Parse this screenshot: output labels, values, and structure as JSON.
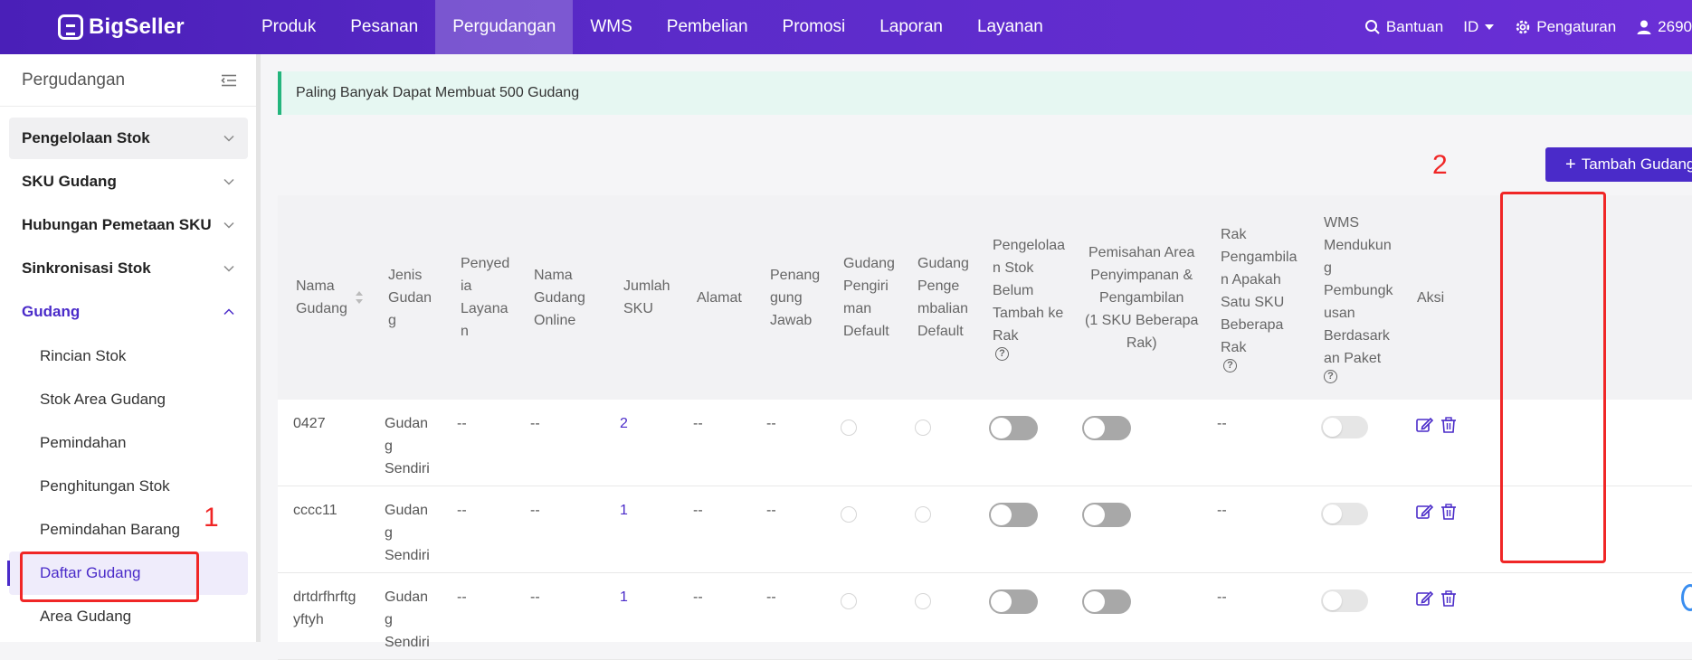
{
  "brand": {
    "name": "BigSeller"
  },
  "nav": {
    "items": [
      "Produk",
      "Pesanan",
      "Pergudangan",
      "WMS",
      "Pembelian",
      "Promosi",
      "Laporan",
      "Layanan"
    ],
    "active": "Pergudangan"
  },
  "topright": {
    "help": "Bantuan",
    "lang": "ID",
    "settings": "Pengaturan",
    "user": "2690"
  },
  "sidebar": {
    "title": "Pergudangan",
    "groups": [
      {
        "label": "Pengelolaan Stok"
      },
      {
        "label": "SKU Gudang"
      },
      {
        "label": "Hubungan Pemetaan SKU"
      },
      {
        "label": "Sinkronisasi Stok"
      },
      {
        "label": "Gudang"
      }
    ],
    "subitems": [
      "Rincian Stok",
      "Stok Area Gudang",
      "Pemindahan",
      "Penghitungan Stok",
      "Pemindahan Barang",
      "Daftar Gudang",
      "Area Gudang"
    ],
    "active_subitem": "Daftar Gudang"
  },
  "notice": "Paling Banyak Dapat Membuat 500 Gudang",
  "add_button": "Tambah Gudang",
  "table": {
    "headers": {
      "nama": [
        "Nama",
        "Gudang"
      ],
      "jenis": [
        "Jenis",
        "Gudan",
        "g"
      ],
      "penyedia": [
        "Penyed",
        "ia",
        "Layana",
        "n"
      ],
      "online": [
        "Nama",
        "Gudang",
        "Online"
      ],
      "jumlah": [
        "Jumlah",
        "SKU"
      ],
      "alamat": [
        "Alamat"
      ],
      "penanggung": [
        "Penang",
        "gung",
        "Jawab"
      ],
      "pengiriman": [
        "Gudang",
        "Pengiri",
        "man",
        "Default"
      ],
      "pengembalian": [
        "Gudang",
        "Penge",
        "mbalian",
        "Default"
      ],
      "pengelolaan": [
        "Pengelolaa",
        "n Stok",
        "Belum",
        "Tambah ke",
        "Rak"
      ],
      "pemisahan": [
        "Pemisahan Area",
        "Penyimpanan &",
        "Pengambilan",
        "(1 SKU Beberapa",
        "Rak)"
      ],
      "rak": [
        "Rak",
        "Pengambila",
        "n Apakah",
        "Satu SKU",
        "Beberapa",
        "Rak"
      ],
      "wms": [
        "WMS",
        "Mendukun",
        "g",
        "Pembungk",
        "usan",
        "Berdasark",
        "an Paket"
      ],
      "aksi": [
        "Aksi"
      ]
    },
    "rows": [
      {
        "nama": [
          "0427"
        ],
        "jenis": [
          "Gudan",
          "g",
          "Sendiri"
        ],
        "penyedia": "--",
        "online": "--",
        "jumlah": "2",
        "alamat": "--",
        "penanggung": "--",
        "rak": "--"
      },
      {
        "nama": [
          "cccc11"
        ],
        "jenis": [
          "Gudan",
          "g",
          "Sendiri"
        ],
        "penyedia": "--",
        "online": "--",
        "jumlah": "1",
        "alamat": "--",
        "penanggung": "--",
        "rak": "--"
      },
      {
        "nama": [
          "drtdrfhrftg",
          "yftyh"
        ],
        "jenis": [
          "Gudan",
          "g",
          "Sendiri"
        ],
        "penyedia": "--",
        "online": "--",
        "jumlah": "1",
        "alamat": "--",
        "penanggung": "--",
        "rak": "--"
      }
    ]
  },
  "annotations": {
    "one": "1",
    "two": "2"
  },
  "colors": {
    "brand": "#4a2bc9",
    "annotation": "#f02626",
    "notice_border": "#24b57d"
  }
}
